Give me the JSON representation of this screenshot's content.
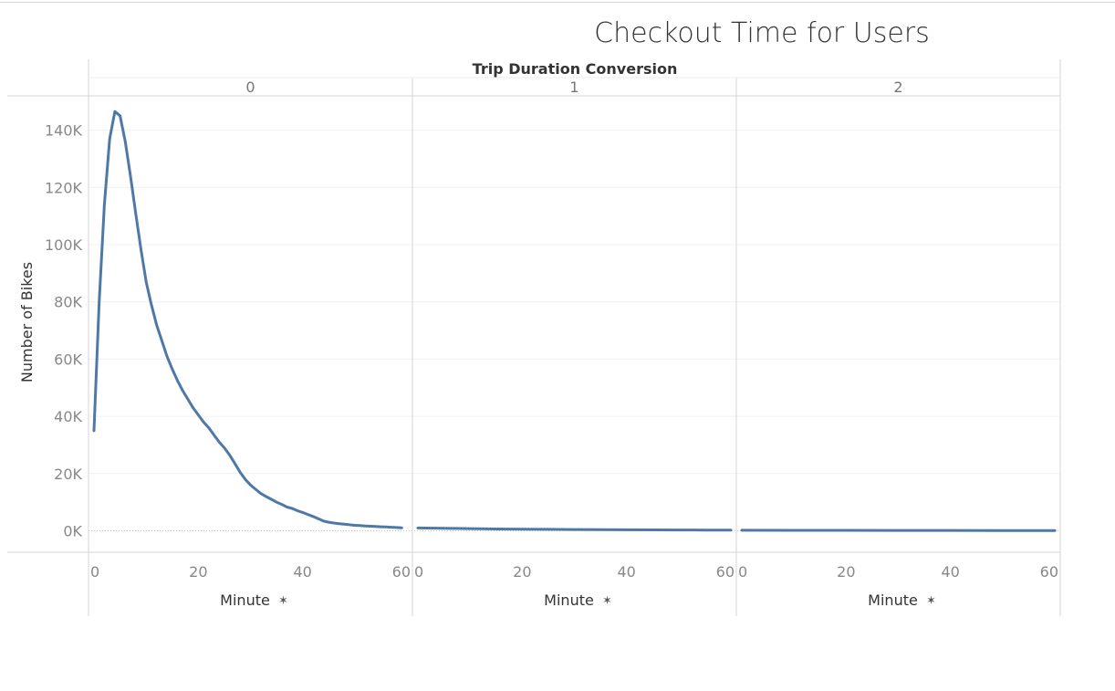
{
  "title": "Checkout Time for Users",
  "colors": {
    "line": "#4e79a7",
    "grid": "#f0f0f0",
    "divider": "#d4d4d4",
    "zeroline": "#c8c8c8"
  },
  "chart_data": {
    "type": "line",
    "title": "Checkout Time for Users",
    "facet_header": "Trip Duration Conversion",
    "facets": [
      "0",
      "1",
      "2"
    ],
    "xlabel": "Minute",
    "xlabel_icon": "pin-icon",
    "ylabel": "Number of Bikes",
    "xlim": [
      0,
      60
    ],
    "ylim": [
      -7500,
      152000
    ],
    "x_ticks": [
      "0",
      "20",
      "40",
      "60"
    ],
    "y_ticks": [
      "0K",
      "20K",
      "40K",
      "60K",
      "80K",
      "100K",
      "120K",
      "140K"
    ],
    "y_tick_values": [
      0,
      20000,
      40000,
      60000,
      80000,
      100000,
      120000,
      140000
    ],
    "grid": true,
    "series": [
      {
        "facet": "0",
        "x": [
          0,
          1,
          2,
          3,
          4,
          5,
          6,
          7,
          8,
          9,
          10,
          11,
          12,
          13,
          14,
          15,
          16,
          17,
          18,
          19,
          20,
          21,
          22,
          23,
          24,
          25,
          26,
          27,
          28,
          29,
          30,
          31,
          32,
          33,
          34,
          35,
          36,
          37,
          38,
          39,
          40,
          41,
          42,
          43,
          44,
          45,
          46,
          47,
          48,
          49,
          50,
          51,
          52,
          53,
          54,
          55,
          56,
          57,
          58,
          59
        ],
        "values": [
          35000,
          80000,
          114000,
          137000,
          146500,
          145000,
          136000,
          124000,
          111000,
          98500,
          87000,
          79000,
          72000,
          66500,
          61000,
          56500,
          52500,
          49000,
          46000,
          43000,
          40500,
          38000,
          36000,
          33500,
          31000,
          29000,
          26500,
          23500,
          20500,
          18000,
          16000,
          14500,
          13000,
          12000,
          11000,
          10000,
          9200,
          8300,
          7800,
          7000,
          6400,
          5700,
          5000,
          4200,
          3400,
          3000,
          2700,
          2500,
          2300,
          2100,
          1900,
          1800,
          1700,
          1600,
          1500,
          1400,
          1350,
          1250,
          1150,
          1050
        ]
      },
      {
        "facet": "1",
        "x": [
          0,
          5,
          10,
          15,
          20,
          25,
          30,
          35,
          40,
          45,
          50,
          55,
          60
        ],
        "values": [
          1000,
          850,
          750,
          650,
          560,
          500,
          440,
          400,
          350,
          310,
          280,
          250,
          220
        ]
      },
      {
        "facet": "2",
        "x": [
          0,
          10,
          20,
          30,
          40,
          50,
          60
        ],
        "values": [
          200,
          170,
          150,
          130,
          110,
          100,
          90
        ]
      }
    ]
  }
}
